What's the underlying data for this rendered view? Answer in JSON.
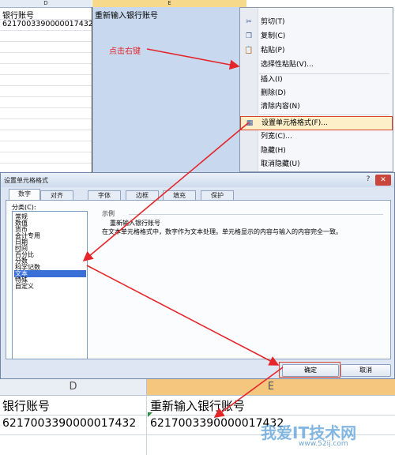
{
  "top_sheet": {
    "col_d": "D",
    "col_e": "E",
    "d_header_cell": "银行账号",
    "d_value": "6217003390000017432",
    "e_header_cell": "重新输入银行账号"
  },
  "annotation": {
    "label": "点击右键"
  },
  "context_menu": {
    "items": [
      {
        "label": "剪切(T)",
        "icon": "scissors-icon"
      },
      {
        "label": "复制(C)",
        "icon": "copy-icon"
      },
      {
        "label": "粘贴(P)",
        "icon": "paste-icon"
      },
      {
        "label": "选择性粘贴(V)...",
        "icon": ""
      },
      {
        "label": "插入(I)",
        "icon": ""
      },
      {
        "label": "删除(D)",
        "icon": ""
      },
      {
        "label": "清除内容(N)",
        "icon": ""
      },
      {
        "label": "设置单元格格式(F)...",
        "icon": "format-cells-icon",
        "highlighted": true
      },
      {
        "label": "列宽(C)...",
        "icon": ""
      },
      {
        "label": "隐藏(H)",
        "icon": ""
      },
      {
        "label": "取消隐藏(U)",
        "icon": ""
      }
    ]
  },
  "dialog": {
    "title": "设置单元格格式",
    "help": "?",
    "close": "✕",
    "tabs": [
      "数字",
      "对齐",
      "字体",
      "边框",
      "填充",
      "保护"
    ],
    "category_label": "分类(C):",
    "categories": [
      "常规",
      "数值",
      "货币",
      "会计专用",
      "日期",
      "时间",
      "百分比",
      "分数",
      "科学记数",
      "文本",
      "特殊",
      "自定义"
    ],
    "selected_category": "文本",
    "sample_label": "示例",
    "sample_value": "重新输入银行账号",
    "description": "在文本单元格格式中，数字作为文本处理。单元格显示的内容与输入的内容完全一致。",
    "ok_label": "确定",
    "cancel_label": "取消"
  },
  "bottom_sheet": {
    "col_d": "D",
    "col_e": "E",
    "d_header_cell": "银行账号",
    "d_value": "6217003390000017432",
    "e_header_cell": "重新输入银行账号",
    "e_value": "6217003390000017432"
  },
  "watermark": {
    "text": "我爱IT技术网",
    "sub": "www.52ij.com"
  },
  "colors": {
    "annotation_red": "#e4262a",
    "selection_blue": "#3a6fd8",
    "header_orange": "#f5c77e"
  }
}
